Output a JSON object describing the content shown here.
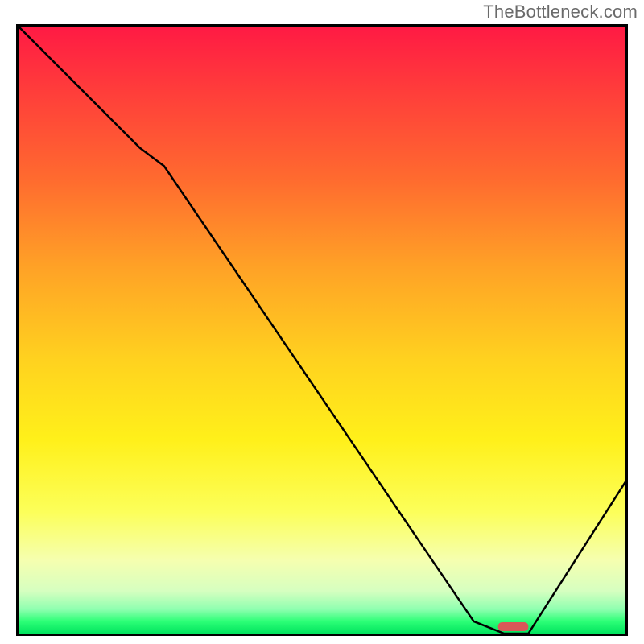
{
  "watermark": "TheBottleneck.com",
  "chart_data": {
    "type": "line",
    "title": "",
    "xlabel": "",
    "ylabel": "",
    "xlim": [
      0,
      100
    ],
    "ylim": [
      0,
      100
    ],
    "grid": false,
    "series": [
      {
        "name": "curve",
        "x": [
          0,
          20,
          24,
          75,
          80,
          84,
          100
        ],
        "y": [
          100,
          80,
          77,
          2,
          0,
          0,
          25
        ]
      }
    ],
    "marker": {
      "name": "optimal-range",
      "x_start": 79,
      "x_end": 84,
      "y": 1.2,
      "color": "#da5858"
    },
    "background_gradient": {
      "direction": "vertical",
      "stops": [
        {
          "pos": 0.0,
          "color": "#ff1a44"
        },
        {
          "pos": 0.1,
          "color": "#ff3b3b"
        },
        {
          "pos": 0.25,
          "color": "#ff6a2f"
        },
        {
          "pos": 0.4,
          "color": "#ffa326"
        },
        {
          "pos": 0.55,
          "color": "#ffd21f"
        },
        {
          "pos": 0.68,
          "color": "#fff01a"
        },
        {
          "pos": 0.8,
          "color": "#fcff5a"
        },
        {
          "pos": 0.88,
          "color": "#f5ffb0"
        },
        {
          "pos": 0.93,
          "color": "#d6ffc0"
        },
        {
          "pos": 0.96,
          "color": "#8fffb0"
        },
        {
          "pos": 0.98,
          "color": "#2dff77"
        },
        {
          "pos": 1.0,
          "color": "#00e35e"
        }
      ]
    }
  }
}
